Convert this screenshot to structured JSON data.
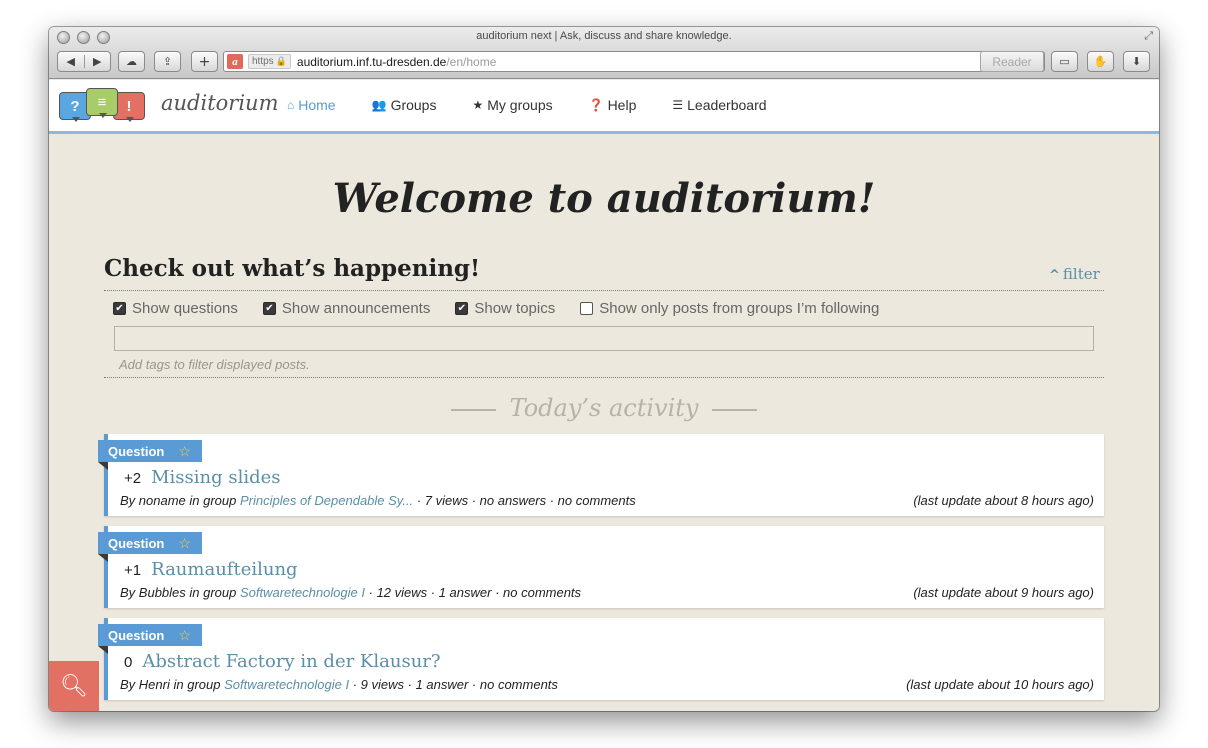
{
  "browser": {
    "window_title": "auditorium next | Ask, discuss and share knowledge.",
    "url_scheme": "https",
    "url_host": "auditorium.inf.tu-dresden.de",
    "url_path": "/en/home",
    "reader_label": "Reader"
  },
  "site": {
    "brand": "auditorium",
    "logo_bubbles": [
      "?",
      "≡",
      "!"
    ],
    "accent_color": "#5a9bd5",
    "brand_red": "#e27163",
    "nav": [
      {
        "label": "Home",
        "icon": "home-icon",
        "active": true
      },
      {
        "label": "Groups",
        "icon": "users-icon",
        "active": false
      },
      {
        "label": "My groups",
        "icon": "star-icon",
        "active": false
      },
      {
        "label": "Help",
        "icon": "help-icon",
        "active": false
      },
      {
        "label": "Leaderboard",
        "icon": "list-icon",
        "active": false
      }
    ]
  },
  "main": {
    "welcome": "Welcome to auditorium!",
    "happening": "Check out what’s happening!",
    "filter_label": "filter",
    "filters": [
      {
        "label": "Show questions",
        "checked": true
      },
      {
        "label": "Show announcements",
        "checked": true
      },
      {
        "label": "Show topics",
        "checked": true
      },
      {
        "label": "Show only posts from groups I’m following",
        "checked": false
      }
    ],
    "tag_hint": "Add tags to filter displayed posts.",
    "section_title": "Today’s activity",
    "posts": [
      {
        "type": "Question",
        "score": "+2",
        "title": "Missing slides",
        "author": "noname",
        "group": "Principles of Dependable Sy...",
        "stats": "· 7 views · no answers · no comments",
        "updated": "(last update about 8 hours ago)"
      },
      {
        "type": "Question",
        "score": "+1",
        "title": "Raumaufteilung",
        "author": "Bubbles",
        "group": "Softwaretechnologie I",
        "stats": "· 12 views · 1 answer · no comments",
        "updated": "(last update about 9 hours ago)"
      },
      {
        "type": "Question",
        "score": "0",
        "title": "Abstract Factory in der Klausur?",
        "author": "Henri",
        "group": "Softwaretechnologie I",
        "stats": "· 9 views · 1 answer · no comments",
        "updated": "(last update about 10 hours ago)"
      }
    ]
  }
}
